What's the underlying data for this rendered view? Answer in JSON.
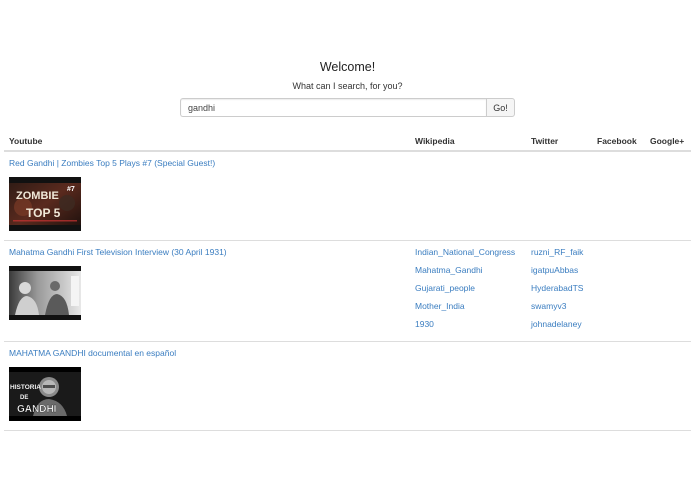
{
  "header": {
    "welcome": "Welcome!",
    "subtitle": "What can I search, for you?"
  },
  "search": {
    "value": "gandhi",
    "button_label": "Go!"
  },
  "table": {
    "columns": [
      "Youtube",
      "Wikipedia",
      "Twitter",
      "Facebook",
      "Google+"
    ],
    "rows": [
      {
        "youtube_title": "Red Gandhi | Zombies Top 5 Plays #7 (Special Guest!)",
        "thumb_text": [
          "ZOMBIE",
          "TOP 5",
          "#7"
        ],
        "wikipedia": [],
        "twitter": []
      },
      {
        "youtube_title": "Mahatma Gandhi First Television Interview (30 April 1931)",
        "thumb_text": [],
        "wikipedia": [
          "Indian_National_Congress",
          "Mahatma_Gandhi",
          "Gujarati_people",
          "Mother_India",
          "1930"
        ],
        "twitter": [
          "ruzni_RF_faik",
          "igatpuAbbas",
          "HyderabadTS",
          "swamyv3",
          "johnadelaney"
        ]
      },
      {
        "youtube_title": "MAHATMA GANDHI documental en español",
        "thumb_text": [
          "HISTORIA",
          "DE",
          "GANDHI"
        ],
        "wikipedia": [],
        "twitter": []
      }
    ]
  },
  "colors": {
    "link": "#3a7dc0",
    "border": "#dddddd"
  }
}
